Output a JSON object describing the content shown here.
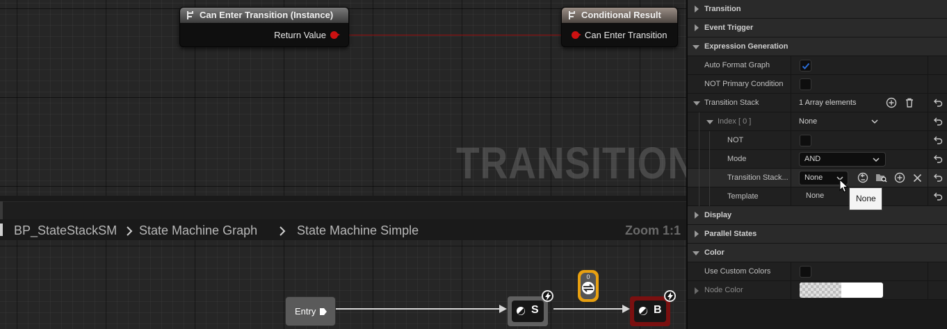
{
  "graph": {
    "watermark": "TRANSITION",
    "node_can_enter": {
      "title": "Can Enter Transition (Instance)",
      "output": "Return Value"
    },
    "node_result": {
      "title": "Conditional Result",
      "input": "Can Enter Transition"
    },
    "pin_color": "#cc1111"
  },
  "breadcrumb": {
    "items": [
      "BP_StateStackSM",
      "State Machine Graph",
      "State Machine Simple"
    ],
    "separators": [
      ">",
      ">"
    ],
    "zoom": "Zoom 1:1"
  },
  "state_machine": {
    "entry_label": "Entry",
    "states": [
      {
        "label": "S",
        "color": "#606060"
      },
      {
        "label": "B",
        "color": "#7a1010"
      }
    ],
    "conduit_number": "0",
    "conduit_color": "#e8a010"
  },
  "details": {
    "categories": {
      "transition": "Transition",
      "event_trigger": "Event Trigger",
      "expression_generation": "Expression Generation",
      "display": "Display",
      "parallel_states": "Parallel States",
      "color": "Color"
    },
    "props": {
      "auto_format_graph": {
        "label": "Auto Format Graph",
        "checked": true
      },
      "not_primary_condition": {
        "label": "NOT Primary Condition",
        "checked": false
      },
      "transition_stack": {
        "label": "Transition Stack",
        "value": "1 Array elements"
      },
      "index_0": {
        "label": "Index [ 0 ]",
        "value": "None"
      },
      "not": {
        "label": "NOT",
        "checked": false
      },
      "mode": {
        "label": "Mode",
        "value": "AND"
      },
      "transition_stack_class": {
        "label": "Transition Stack...",
        "value": "None"
      },
      "template": {
        "label": "Template",
        "value": "None"
      },
      "use_custom_colors": {
        "label": "Use Custom Colors",
        "checked": false
      },
      "node_color": {
        "label": "Node Color"
      }
    },
    "tooltip": "None",
    "accent_color": "#2a6cd4"
  }
}
